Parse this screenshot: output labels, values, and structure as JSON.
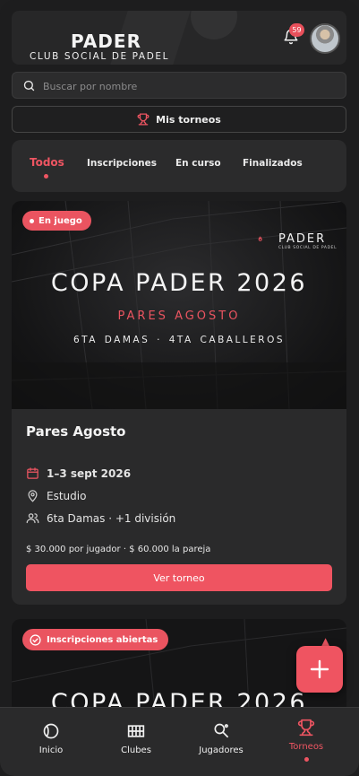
{
  "header": {
    "brand_title": "PADER",
    "brand_subtitle": "CLUB SOCIAL DE PADEL",
    "notification_count": "59"
  },
  "search": {
    "placeholder": "Buscar por nombre"
  },
  "my_tournaments": {
    "label": "Mis torneos"
  },
  "tabs": [
    {
      "label": "Todos",
      "active": true
    },
    {
      "label": "Inscripciones",
      "active": false
    },
    {
      "label": "En curso",
      "active": false
    },
    {
      "label": "Finalizados",
      "active": false
    }
  ],
  "tournaments": [
    {
      "status": "En juego",
      "logo_name": "PADER",
      "logo_sub": "CLUB SOCIAL DE PADEL",
      "banner_title": "COPA PADER 2026",
      "banner_subtitle": "PARES AGOSTO",
      "banner_categories": "6TA DAMAS · 4TA CABALLEROS",
      "title": "Pares Agosto",
      "date": "1–3 sept 2026",
      "location": "Estudio",
      "divisions": "6ta Damas · +1 división",
      "price": "$ 30.000 por jugador · $ 60.000 la pareja",
      "button_label": "Ver torneo"
    },
    {
      "status": "Inscripciones abiertas",
      "banner_title": "COPA PADER 2026"
    }
  ],
  "bottom_nav": [
    {
      "label": "Inicio",
      "icon": "ball-icon"
    },
    {
      "label": "Clubes",
      "icon": "court-icon"
    },
    {
      "label": "Jugadores",
      "icon": "racket-icon"
    },
    {
      "label": "Torneos",
      "icon": "trophy-icon",
      "active": true
    }
  ],
  "colors": {
    "accent": "#ee5562",
    "background": "#1d1d1e",
    "surface": "#2a2a2b"
  }
}
